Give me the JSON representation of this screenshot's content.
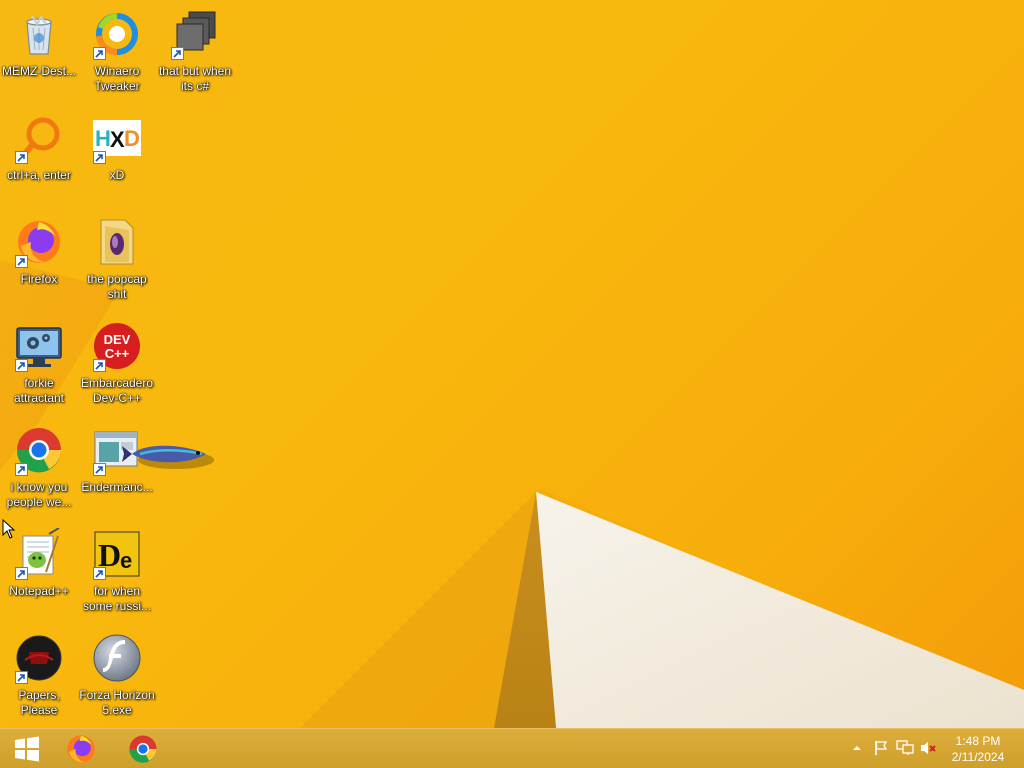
{
  "desktop": {
    "icons": [
      {
        "name": "recycle-bin-icon",
        "label": "MEMZ-Dest...",
        "shortcut": false
      },
      {
        "name": "winaero-tweaker-icon",
        "label": "Winaero Tweaker",
        "shortcut": true
      },
      {
        "name": "stacked-windows-icon",
        "label": "that but when its c#",
        "shortcut": true
      },
      {
        "name": "orange-search-ring-icon",
        "label": "ctrl+a, enter",
        "shortcut": true
      },
      {
        "name": "hxd-hex-editor-icon",
        "label": "xD",
        "shortcut": true
      },
      {
        "name": "firefox-icon",
        "label": "Firefox",
        "shortcut": true
      },
      {
        "name": "folder-icon",
        "label": "the popcap shit",
        "shortcut": false
      },
      {
        "name": "monitor-gears-icon",
        "label": "forkie attractant",
        "shortcut": true
      },
      {
        "name": "dev-cpp-icon",
        "label": "Embarcadero Dev-C++",
        "shortcut": true
      },
      {
        "name": "chrome-icon",
        "label": "i know you people we...",
        "shortcut": true
      },
      {
        "name": "endermanch-window-icon",
        "label": "Endermanc...",
        "shortcut": true
      },
      {
        "name": "notepad-plus-plus-icon",
        "label": "Notepad++",
        "shortcut": true
      },
      {
        "name": "de-logo-icon",
        "label": "for when some russi...",
        "shortcut": true
      },
      {
        "name": "papers-please-icon",
        "label": "Papers, Please",
        "shortcut": true
      },
      {
        "name": "flash-player-icon",
        "label": "Forza Horizon 5.exe",
        "shortcut": false
      }
    ]
  },
  "taskbar": {
    "pinned": [
      {
        "name": "windows-start-icon"
      },
      {
        "name": "firefox-icon"
      },
      {
        "name": "chrome-icon"
      }
    ],
    "tray": [
      {
        "name": "chevron-up-icon"
      },
      {
        "name": "flag-icon"
      },
      {
        "name": "network-icon"
      },
      {
        "name": "speaker-muted-icon"
      }
    ],
    "clock": {
      "time": "1:48 PM",
      "date": "2/11/2024"
    }
  },
  "colors": {
    "wallpaper": "#f7b10f",
    "taskbar": "#d6a634",
    "paper": "#f3ede2"
  }
}
